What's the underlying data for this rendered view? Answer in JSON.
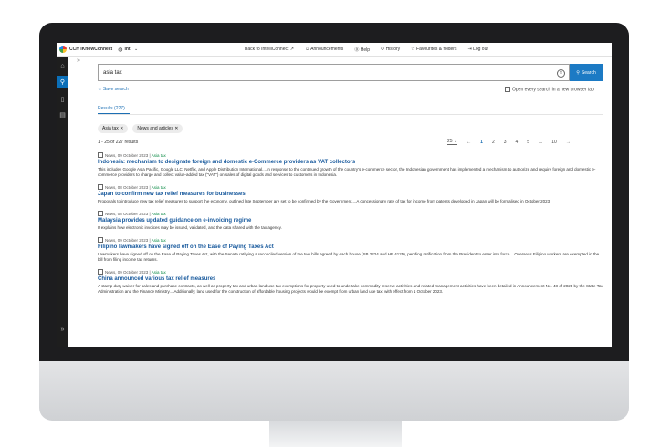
{
  "app": {
    "brand": "CCH iKnowConnect",
    "lang": "Int."
  },
  "toplinks": [
    {
      "label": "Back to IntelliConnect ↗"
    },
    {
      "label": "☺ Announcements"
    },
    {
      "label": "⓪ Help"
    },
    {
      "label": "↺ History"
    },
    {
      "label": "☆ Favourites & folders"
    },
    {
      "label": "⇥ Log out"
    }
  ],
  "search": {
    "value": "asia tax",
    "button": "Search"
  },
  "save_search": "☆ Save search",
  "new_tab": "Open every search in a new browser tab",
  "results_tab": "Results (227)",
  "chips": [
    {
      "label": "Asia tax ✕"
    },
    {
      "label": "News and articles ✕"
    }
  ],
  "count": "1 - 25 of 227 results",
  "pager": {
    "per_page": "25",
    "prev": "←",
    "pages": [
      "1",
      "2",
      "3",
      "4",
      "5",
      "...",
      "10"
    ],
    "next": "→"
  },
  "results": [
    {
      "meta": "News, 09 October 2023 |",
      "tag": "Asia tax",
      "title": "Indonesia: mechanism to designate foreign and domestic e-Commerce providers as VAT collectors",
      "snippet": "This includes Google Asia Pacific, Google LLC, Netflix, and Apple Distribution International....In response to the continued growth of the country's e-commerce sector, the Indonesian government has implemented a mechanism to authorize and require foreign and domestic e-commerce providers to charge and collect value-added tax (\"VAT\") on sales of digital goods and services to customers in Indonesia."
    },
    {
      "meta": "News, 08 October 2023 |",
      "tag": "Asia tax",
      "title": "Japan to confirm new tax relief measures for businesses",
      "snippet": "Proposals to introduce new tax relief measures to support the economy, outlined late September are set to be confirmed by the Government....A concessionary rate of tax for income from patents developed in Japan will be formalised in October 2023."
    },
    {
      "meta": "News, 08 October 2023 |",
      "tag": "Asia tax",
      "title": "Malaysia provides updated guidance on e-invoicing regime",
      "snippet": "It explains how electronic invoices may be issued, validated, and the data shared with the tax agency."
    },
    {
      "meta": "News, 09 October 2023 |",
      "tag": "Asia tax",
      "title": "Filipino lawmakers have signed off on the Ease of Paying Taxes Act",
      "snippet": "Lawmakers have signed off on the Ease of Paying Taxes Act, with the Senate ratifying a reconciled version of the two bills agreed by each house (SB 2224 and HB 4125), pending ratification from the President to enter into force....Overseas Filipino workers are exempted in the bill from filing income tax returns."
    },
    {
      "meta": "News, 09 October 2023 |",
      "tag": "Asia tax",
      "title": "China announced various tax relief measures",
      "snippet": "A stamp duty waiver for sales and purchase contracts, as well as property tax and urban land use tax exemptions for property used to undertake commodity reserve activities and related management activities have been detailed in Announcement No. 48 of 2023 by the State Tax Administration and the Finance Ministry....Additionally, land used for the construction of affordable housing projects would be exempt from urban land use tax, with effect from 1 October 2023."
    }
  ]
}
